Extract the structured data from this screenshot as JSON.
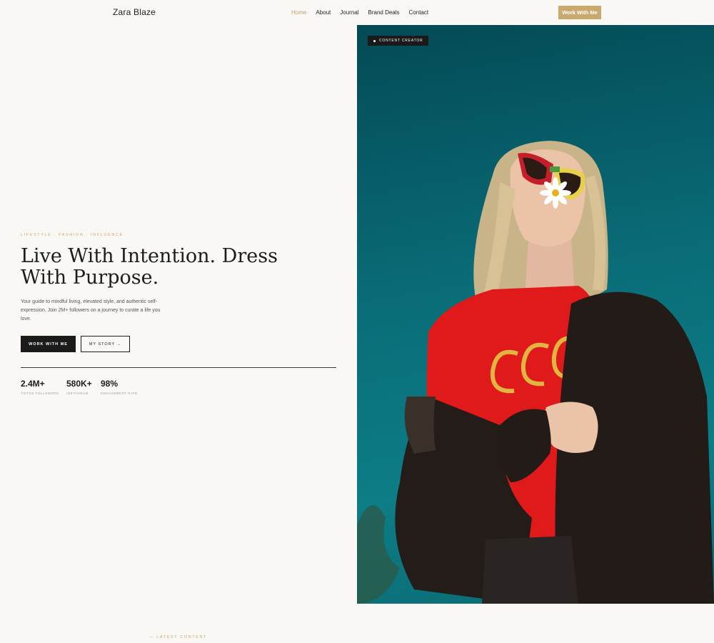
{
  "nav": {
    "brand": "Zara Blaze",
    "links": [
      "Home",
      "About",
      "Journal",
      "Brand Deals",
      "Contact"
    ],
    "active": "Home",
    "cta": "Work With Me"
  },
  "hero": {
    "eyebrow": "LIFESTYLE · FASHION · INFLUENCE",
    "headline": "Live With Intention. Dress With Purpose.",
    "lede": "Your guide to mindful living, elevated style, and authentic self-expression. Join 2M+ followers on a journey to curate a life you love.",
    "primary_button": "WORK WITH ME",
    "secondary_button": "MY STORY →",
    "stats": [
      {
        "value": "2.4M+",
        "label": "TIKTOK FOLLOWERS"
      },
      {
        "value": "580K+",
        "label": "INSTAGRAM"
      },
      {
        "value": "98%",
        "label": "ENGAGEMENT RATE"
      }
    ],
    "badge": "CONTENT CREATOR"
  },
  "section": {
    "label": "— LATEST CONTENT"
  },
  "colors": {
    "accent": "#c9a96e",
    "dark": "#1b1b1b",
    "background": "#f9f8f5",
    "photo_teal": "#0a6d78"
  }
}
